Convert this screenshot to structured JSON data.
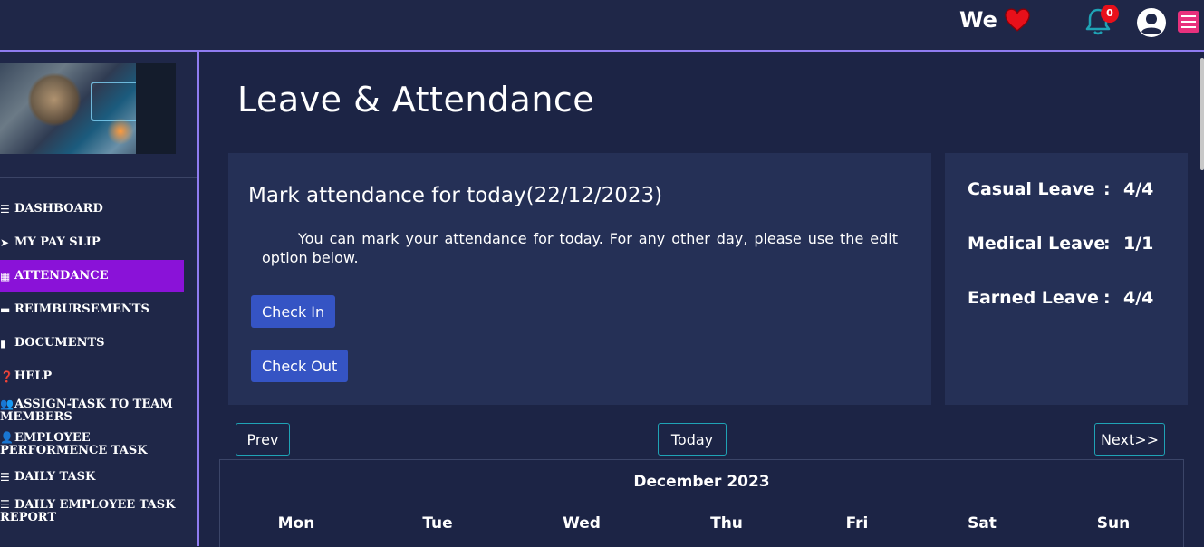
{
  "topbar": {
    "brand_text": "We",
    "notification_count": "0",
    "colors": {
      "heart": "#e8101a",
      "bell": "#1fa3b5",
      "menu": "#e8317d",
      "badge": "#e8101a"
    }
  },
  "sidebar": {
    "items": [
      {
        "icon": "bars-icon",
        "label": "DASHBOARD"
      },
      {
        "icon": "paper-plane-icon",
        "label": "MY PAY SLIP"
      },
      {
        "icon": "calendar-icon",
        "label": "ATTENDANCE",
        "active": true
      },
      {
        "icon": "credit-card-icon",
        "label": "REIMBURSEMENTS"
      },
      {
        "icon": "file-icon",
        "label": "DOCUMENTS"
      },
      {
        "icon": "question-circle-icon",
        "label": "HELP"
      },
      {
        "icon": "users-icon",
        "label": "ASSIGN-TASK TO TEAM MEMBERS"
      },
      {
        "icon": "user-edit-icon",
        "label": "EMPLOYEE PERFORMENCE TASK"
      },
      {
        "icon": "list-check-icon",
        "label": "DAILY TASK"
      },
      {
        "icon": "list-check-icon",
        "label": "DAILY EMPLOYEE TASK REPORT"
      }
    ],
    "active_color": "#8a12d8"
  },
  "main": {
    "title": "Leave & Attendance",
    "attendance": {
      "heading": "Mark attendance for today(22/12/2023)",
      "description": "You can mark your attendance for today. For any other day, please use the edit option below.",
      "check_in_label": "Check In",
      "check_out_label": "Check Out"
    },
    "leaves": [
      {
        "label": "Casual Leave",
        "colon": ":",
        "value": "4/4"
      },
      {
        "label": "Medical Leave",
        "colon": ":",
        "value": "1/1"
      },
      {
        "label": "Earned Leave",
        "colon": ":",
        "value": "4/4"
      }
    ],
    "calendar": {
      "prev_label": "Prev",
      "today_label": "Today",
      "next_label": "Next>>",
      "month_title": "December 2023",
      "weekdays": [
        "Mon",
        "Tue",
        "Wed",
        "Thu",
        "Fri",
        "Sat",
        "Sun"
      ]
    }
  }
}
